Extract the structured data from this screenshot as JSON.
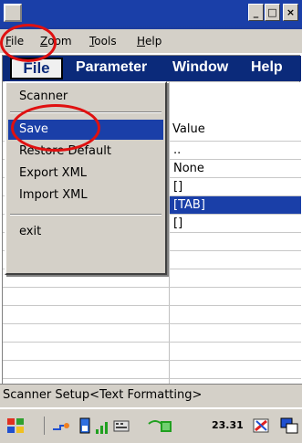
{
  "window": {
    "controls": {
      "minimize": "_",
      "maximize": "□",
      "close": "×"
    }
  },
  "outer_menu": [
    {
      "label": "File",
      "mnemonic": "F"
    },
    {
      "label": "Zoom",
      "mnemonic": "Z"
    },
    {
      "label": "Tools",
      "mnemonic": "T"
    },
    {
      "label": "Help",
      "mnemonic": "H"
    }
  ],
  "inner_menu": {
    "file": "File",
    "items": [
      "Parameter",
      "Window",
      "Help"
    ]
  },
  "dropdown": {
    "items": [
      "Scanner",
      "Save",
      "Restore Default",
      "Export XML",
      "Import XML",
      "exit"
    ],
    "selected": "Save"
  },
  "grid": {
    "value_header": "Value",
    "rows": [
      "..",
      "None",
      "[]",
      "[TAB]",
      "[]"
    ],
    "selected_row": "[TAB]"
  },
  "status_text": "Scanner Setup<Text Formatting>",
  "taskbar": {
    "time": "23.31",
    "icons": [
      "start-icon",
      "network-icon",
      "battery-icon",
      "signal-icon",
      "keyboard-icon",
      "wifi-icon",
      "tray-app-icon",
      "copy-icon"
    ]
  },
  "annotation_color": "#e01010"
}
